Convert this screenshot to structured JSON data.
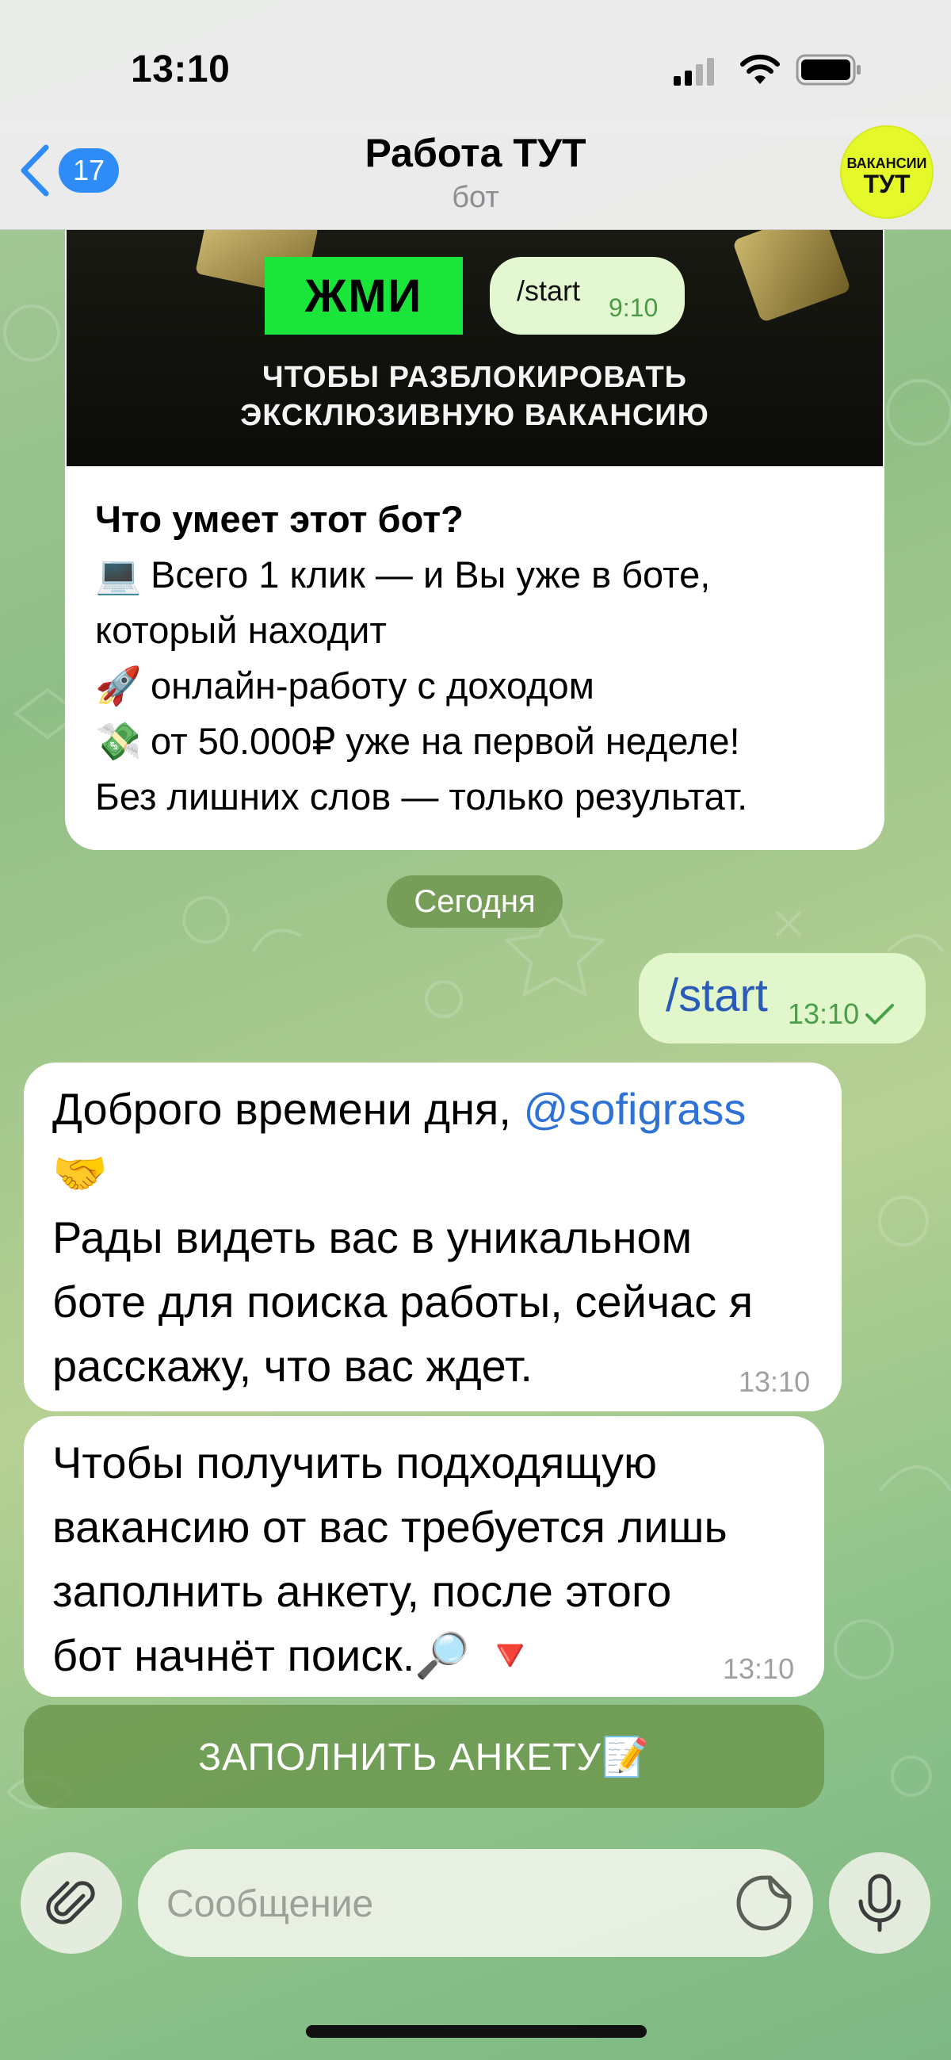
{
  "status_bar": {
    "time": "13:10"
  },
  "header": {
    "back_count": "17",
    "title": "Работа ТУТ",
    "subtitle": "бот",
    "avatar_line1": "ВАКАНСИИ",
    "avatar_line2": "ТУТ"
  },
  "bot_card": {
    "image_button": "ЖМИ",
    "image_bubble_text": "/start",
    "image_bubble_time": "9:10",
    "image_caption_line1": "ЧТОБЫ РАЗБЛОКИРОВАТЬ",
    "image_caption_line2": "ЭКСКЛЮЗИВНУЮ ВАКАНСИЮ",
    "title": "Что умеет этот бот?",
    "line1_emoji": "💻",
    "line1": "Всего 1 клик — и Вы уже в боте,",
    "line2": "который находит",
    "line3_emoji": "🚀",
    "line3": "онлайн-работу с доходом",
    "line4_emoji": "💸",
    "line4": "от 50.000₽ уже на первой неделе!",
    "line5": "Без лишних слов — только результат."
  },
  "date_chip": "Сегодня",
  "outgoing": {
    "text": "/start",
    "time": "13:10"
  },
  "messages": [
    {
      "greeting": "Доброго времени дня, ",
      "mention": "@sofigrass",
      "emoji": "🤝",
      "line2": "Рады видеть вас в уникальном",
      "line3": "боте для поиска работы, сейчас я",
      "line4": "расскажу, что вас ждет.",
      "time": "13:10"
    },
    {
      "line1": "Чтобы получить подходящую",
      "line2": "вакансию от вас требуется лишь",
      "line3": "заполнить анкету, после этого",
      "line4": "бот начнёт поиск.🔎 🔻",
      "time": "13:10"
    }
  ],
  "inline_button": "ЗАПОЛНИТЬ АНКЕТУ📝",
  "composer": {
    "placeholder": "Сообщение"
  },
  "colors": {
    "accent": "#2f8cf6",
    "outgoing_bubble": "#e1f7cb",
    "button_green": "#6a964c"
  }
}
